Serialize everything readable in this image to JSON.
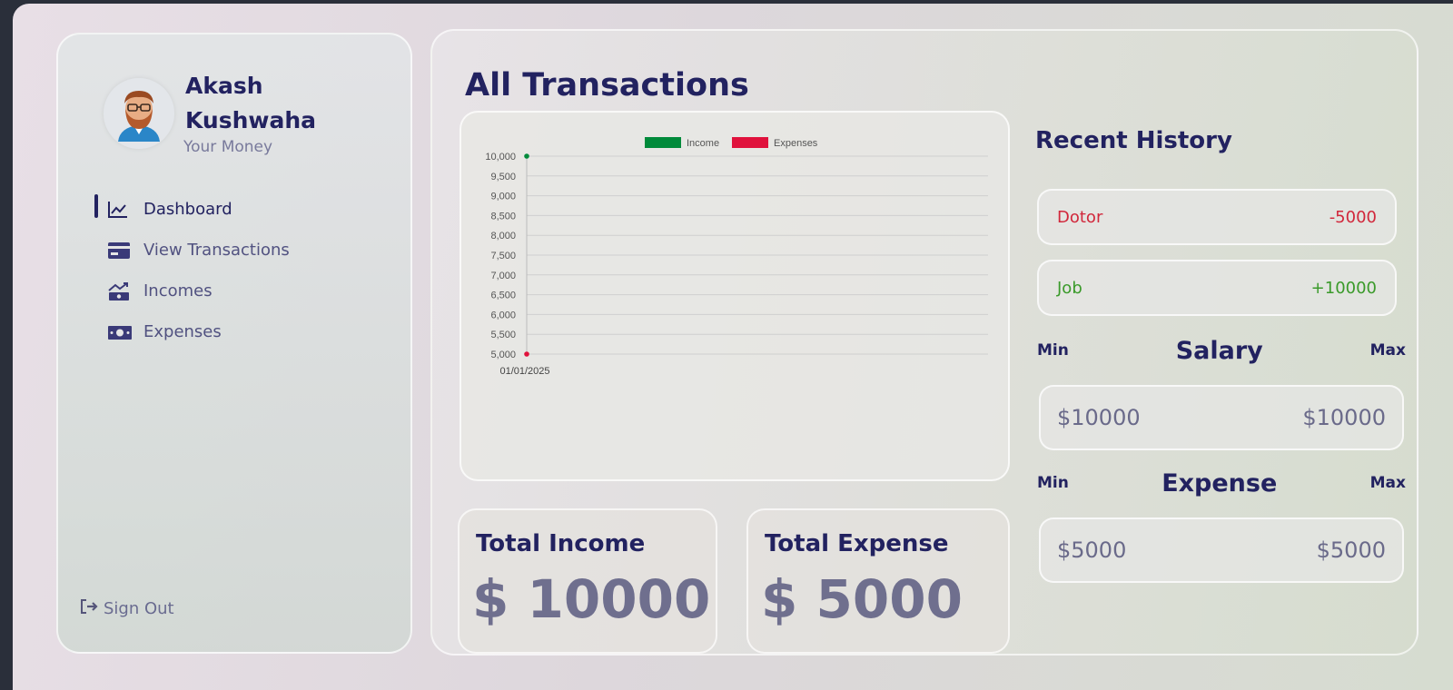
{
  "user": {
    "name": "Akash Kushwaha",
    "subtitle": "Your Money"
  },
  "menu": [
    {
      "label": "Dashboard",
      "icon": "chart-trend-icon",
      "active": true
    },
    {
      "label": "View Transactions",
      "icon": "credit-card-icon",
      "active": false
    },
    {
      "label": "Incomes",
      "icon": "income-icon",
      "active": false
    },
    {
      "label": "Expenses",
      "icon": "money-bill-icon",
      "active": false
    }
  ],
  "signout": {
    "label": "Sign Out",
    "icon": "sign-out-icon"
  },
  "main": {
    "title": "All Transactions"
  },
  "chart_data": {
    "type": "line",
    "title": "",
    "xlabel": "",
    "ylabel": "",
    "categories": [
      "01/01/2025"
    ],
    "series": [
      {
        "name": "Income",
        "values": [
          10000
        ],
        "color": "#008a3a"
      },
      {
        "name": "Expenses",
        "values": [
          5000
        ],
        "color": "#e0123c"
      }
    ],
    "ylim": [
      5000,
      10000
    ],
    "yticks": [
      "10,000",
      "9,500",
      "9,000",
      "8,500",
      "8,000",
      "7,500",
      "7,000",
      "6,500",
      "6,000",
      "5,500",
      "5,000"
    ],
    "grid": true,
    "legend": "top"
  },
  "totals": {
    "income_label": "Total Income",
    "income_value": "$ 10000",
    "expense_label": "Total Expense",
    "expense_value": "$ 5000"
  },
  "history": {
    "title": "Recent History",
    "items": [
      {
        "title": "Dotor",
        "amount": "-5000",
        "color": "#d1273b"
      },
      {
        "title": "Job",
        "amount": "+10000",
        "color": "#3a9a2a"
      }
    ]
  },
  "salary": {
    "min_label": "Min",
    "title": "Salary",
    "max_label": "Max",
    "min": "$10000",
    "max": "$10000"
  },
  "expense": {
    "min_label": "Min",
    "title": "Expense",
    "max_label": "Max",
    "min": "$5000",
    "max": "$5000"
  }
}
